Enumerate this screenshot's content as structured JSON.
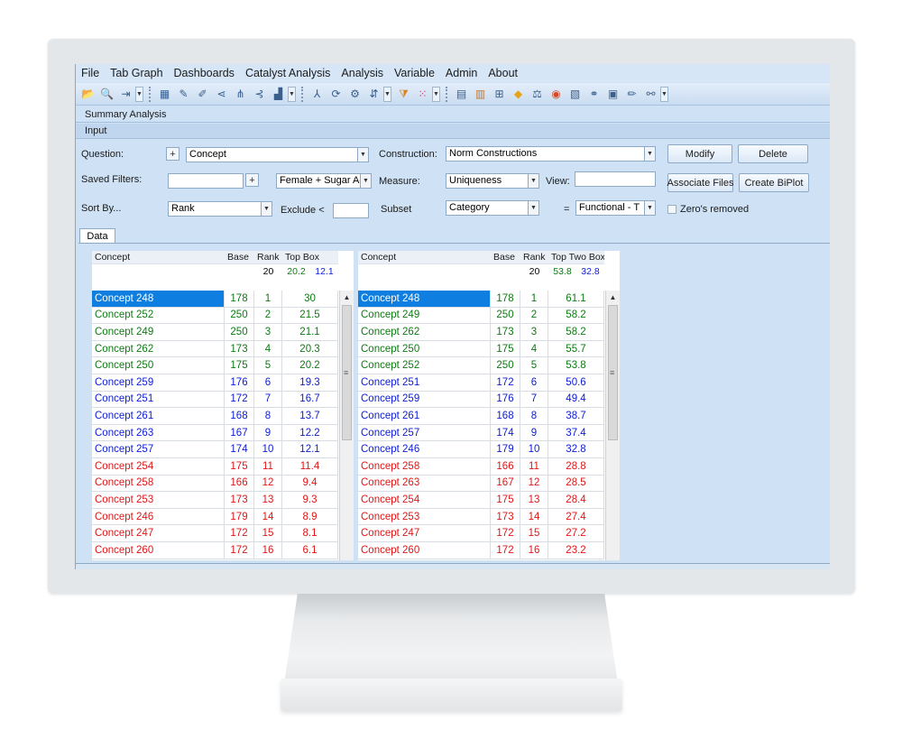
{
  "menu": [
    "File",
    "Tab Graph",
    "Dashboards",
    "Catalyst Analysis",
    "Analysis",
    "Variable",
    "Admin",
    "About"
  ],
  "toolbar_icons": [
    "open-folder-icon",
    "zoom-icon",
    "import-icon",
    "dropdown-arrow",
    "grip",
    "chart-icon",
    "pen-icon",
    "pen-faded-icon",
    "share-icon",
    "network-icon",
    "network-alt-icon",
    "bar-stack-icon",
    "dropdown-arrow",
    "grip",
    "hierarchy-icon",
    "cycle-icon",
    "gear-cluster-icon",
    "filter-arrow-icon",
    "dropdown-arrow",
    "funnel-icon",
    "grid-dots-icon",
    "dropdown-arrow",
    "grip",
    "window-icon",
    "calendar-icon",
    "add-box-icon",
    "diamond-icon",
    "balance-icon",
    "compass-icon",
    "report-icon",
    "link-icon",
    "image-icon",
    "edit-icon",
    "bike-icon",
    "dropdown-arrow"
  ],
  "sections": {
    "summary": "Summary Analysis",
    "input": "Input"
  },
  "form": {
    "question_label": "Question:",
    "question_value": "Concept",
    "construction_label": "Construction:",
    "construction_value": "Norm Constructions",
    "modify": "Modify",
    "delete": "Delete",
    "saved_filters_label": "Saved Filters:",
    "filter_value": "Female + Sugar Ac",
    "measure_label": "Measure:",
    "measure_value": "Uniqueness",
    "view_label": "View:",
    "associate_files": "Associate Files",
    "create_biplot": "Create BiPlot",
    "sort_by_label": "Sort By...",
    "sort_value": "Rank",
    "exclude_label": "Exclude <",
    "subset_label": "Subset",
    "subset_value": "Category",
    "equals": "=",
    "subset_filter_value": "Functional - T",
    "zeros_removed": "Zero's removed"
  },
  "tabs": {
    "data": "Data"
  },
  "colors": {
    "green": "#0d7a12",
    "blue": "#0b1bd6",
    "red": "#e11515",
    "selected": "#0e7ee0"
  },
  "left_table": {
    "headers": [
      "Concept",
      "Base",
      "Rank",
      "Top Box"
    ],
    "summary": {
      "rank": "20",
      "val_a": "20.2",
      "val_b": "12.1"
    },
    "rows": [
      {
        "name": "Concept 248",
        "base": "178",
        "rank": "1",
        "value": "30",
        "color": "green"
      },
      {
        "name": "Concept 252",
        "base": "250",
        "rank": "2",
        "value": "21.5",
        "color": "green"
      },
      {
        "name": "Concept 249",
        "base": "250",
        "rank": "3",
        "value": "21.1",
        "color": "green"
      },
      {
        "name": "Concept 262",
        "base": "173",
        "rank": "4",
        "value": "20.3",
        "color": "green"
      },
      {
        "name": "Concept 250",
        "base": "175",
        "rank": "5",
        "value": "20.2",
        "color": "green"
      },
      {
        "name": "Concept 259",
        "base": "176",
        "rank": "6",
        "value": "19.3",
        "color": "blue"
      },
      {
        "name": "Concept 251",
        "base": "172",
        "rank": "7",
        "value": "16.7",
        "color": "blue"
      },
      {
        "name": "Concept 261",
        "base": "168",
        "rank": "8",
        "value": "13.7",
        "color": "blue"
      },
      {
        "name": "Concept 263",
        "base": "167",
        "rank": "9",
        "value": "12.2",
        "color": "blue"
      },
      {
        "name": "Concept 257",
        "base": "174",
        "rank": "10",
        "value": "12.1",
        "color": "blue"
      },
      {
        "name": "Concept 254",
        "base": "175",
        "rank": "11",
        "value": "11.4",
        "color": "red"
      },
      {
        "name": "Concept 258",
        "base": "166",
        "rank": "12",
        "value": "9.4",
        "color": "red"
      },
      {
        "name": "Concept 253",
        "base": "173",
        "rank": "13",
        "value": "9.3",
        "color": "red"
      },
      {
        "name": "Concept 246",
        "base": "179",
        "rank": "14",
        "value": "8.9",
        "color": "red"
      },
      {
        "name": "Concept 247",
        "base": "172",
        "rank": "15",
        "value": "8.1",
        "color": "red"
      },
      {
        "name": "Concept 260",
        "base": "172",
        "rank": "16",
        "value": "6.1",
        "color": "red"
      }
    ]
  },
  "right_table": {
    "headers": [
      "Concept",
      "Base",
      "Rank",
      "Top Two Box"
    ],
    "summary": {
      "rank": "20",
      "val_a": "53.8",
      "val_b": "32.8"
    },
    "rows": [
      {
        "name": "Concept 248",
        "base": "178",
        "rank": "1",
        "value": "61.1",
        "color": "green"
      },
      {
        "name": "Concept 249",
        "base": "250",
        "rank": "2",
        "value": "58.2",
        "color": "green"
      },
      {
        "name": "Concept 262",
        "base": "173",
        "rank": "3",
        "value": "58.2",
        "color": "green"
      },
      {
        "name": "Concept 250",
        "base": "175",
        "rank": "4",
        "value": "55.7",
        "color": "green"
      },
      {
        "name": "Concept 252",
        "base": "250",
        "rank": "5",
        "value": "53.8",
        "color": "green"
      },
      {
        "name": "Concept 251",
        "base": "172",
        "rank": "6",
        "value": "50.6",
        "color": "blue"
      },
      {
        "name": "Concept 259",
        "base": "176",
        "rank": "7",
        "value": "49.4",
        "color": "blue"
      },
      {
        "name": "Concept 261",
        "base": "168",
        "rank": "8",
        "value": "38.7",
        "color": "blue"
      },
      {
        "name": "Concept 257",
        "base": "174",
        "rank": "9",
        "value": "37.4",
        "color": "blue"
      },
      {
        "name": "Concept 246",
        "base": "179",
        "rank": "10",
        "value": "32.8",
        "color": "blue"
      },
      {
        "name": "Concept 258",
        "base": "166",
        "rank": "11",
        "value": "28.8",
        "color": "red"
      },
      {
        "name": "Concept 263",
        "base": "167",
        "rank": "12",
        "value": "28.5",
        "color": "red"
      },
      {
        "name": "Concept 254",
        "base": "175",
        "rank": "13",
        "value": "28.4",
        "color": "red"
      },
      {
        "name": "Concept 253",
        "base": "173",
        "rank": "14",
        "value": "27.4",
        "color": "red"
      },
      {
        "name": "Concept 247",
        "base": "172",
        "rank": "15",
        "value": "27.2",
        "color": "red"
      },
      {
        "name": "Concept 260",
        "base": "172",
        "rank": "16",
        "value": "23.2",
        "color": "red"
      }
    ]
  }
}
